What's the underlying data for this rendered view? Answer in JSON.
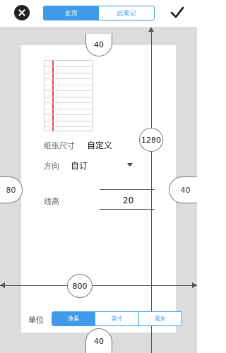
{
  "header": {
    "tabs": [
      {
        "label": "此页",
        "active": true
      },
      {
        "label": "此笔记",
        "active": false
      }
    ]
  },
  "paper": {
    "size_label": "纸张尺寸",
    "size_value": "自定义",
    "orientation_label": "方向",
    "orientation_value": "自订",
    "line_height_label": "线高",
    "line_height_value": "20"
  },
  "dimensions": {
    "margin_top": "40",
    "margin_bottom": "40",
    "margin_left": "80",
    "margin_right": "40",
    "height": "1280",
    "width": "800"
  },
  "units": {
    "label": "单位",
    "options": [
      {
        "label": "像素",
        "active": true
      },
      {
        "label": "英寸",
        "active": false
      },
      {
        "label": "毫米",
        "active": false
      }
    ]
  },
  "colors": {
    "accent": "#3d9be9",
    "canvas": "#dcdcdc",
    "margin_line": "#e4434b"
  }
}
